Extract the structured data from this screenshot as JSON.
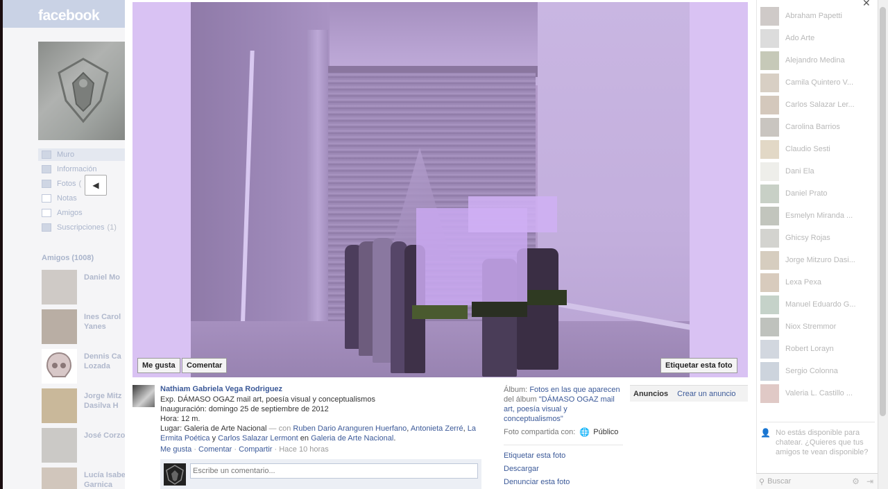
{
  "background_page": {
    "logo": "facebook",
    "nav": [
      {
        "label": "Muro",
        "count": ""
      },
      {
        "label": "Información",
        "count": ""
      },
      {
        "label": "Fotos",
        "count": "("
      },
      {
        "label": "Notas",
        "count": ""
      },
      {
        "label": "Amigos",
        "count": ""
      },
      {
        "label": "Suscripciones",
        "count": "(1)"
      }
    ],
    "friends_title": "Amigos (1008)",
    "friends": [
      {
        "line1": "Daniel Mo",
        "line2": ""
      },
      {
        "line1": "Ines Carol",
        "line2": "Yanes"
      },
      {
        "line1": "Dennis Ca",
        "line2": "Lozada"
      },
      {
        "line1": "Jorge Mitz",
        "line2": "Dasilva H"
      },
      {
        "line1": "José Corzo",
        "line2": ""
      },
      {
        "line1": "Lucía Isabe",
        "line2": "Garnica"
      }
    ]
  },
  "viewer": {
    "like_button": "Me gusta",
    "comment_button": "Comentar",
    "tag_button": "Etiquetar esta foto",
    "owner_name": "Nathiam Gabriela Vega Rodriguez",
    "caption": {
      "line1": "Exp. DÁMASO OGAZ mail art, poesía visual y conceptualismos",
      "line2": "Inauguración: domingo 25 de septiembre de 2012",
      "line3": "Hora: 12 m.",
      "place_prefix": "Lugar: Galeria de Arte Nacional",
      "with_prefix": "— con",
      "tag1": "Ruben Dario Aranguren Huerfano",
      "tag2": "Antonieta Zerré",
      "tag3": "La Ermita Poética",
      "and_word": "y",
      "tag4": "Carlos Salazar Lermont",
      "in_word": "en",
      "place_link": "Galeria de Arte Nacional",
      "period": "."
    },
    "actions": {
      "like": "Me gusta",
      "comment": "Comentar",
      "share": "Compartir",
      "sep": "·",
      "time": "Hace 10 horas"
    },
    "comment_placeholder": "Escribe un comentario...",
    "album": {
      "label": "Álbum:",
      "link": "Fotos en las que aparecen",
      "mid": "del álbum",
      "album_name": "\"DÁMASO OGAZ mail art, poesía visual y conceptualismos\""
    },
    "shared_with_label": "Foto compartida con:",
    "shared_with_value": "Público",
    "side_links": [
      "Etiquetar esta foto",
      "Descargar",
      "Denunciar esta foto"
    ],
    "ads": {
      "title": "Anuncios",
      "create": "Crear un anuncio"
    }
  },
  "chat": {
    "contacts": [
      "Abraham Papetti",
      "Ado Arte",
      "Alejandro Medina",
      "Camila Quintero V...",
      "Carlos Salazar Ler...",
      "Carolina Barrios",
      "Claudio Sesti",
      "Dani Ela",
      "Daniel Prato",
      "Esmelyn Miranda ...",
      "Ghicsy Rojas",
      "Jorge Mitzuro Dasi...",
      "Lexa Pexa",
      "Manuel Eduardo G...",
      "Niox Stremmor",
      "Robert Lorayn",
      "Sergio Colonna",
      "Valeria L. Castillo ..."
    ],
    "offline_text": "No estás disponible para chatear. ¿Quieres que tus amigos te vean disponible?",
    "search_placeholder": "Buscar"
  }
}
